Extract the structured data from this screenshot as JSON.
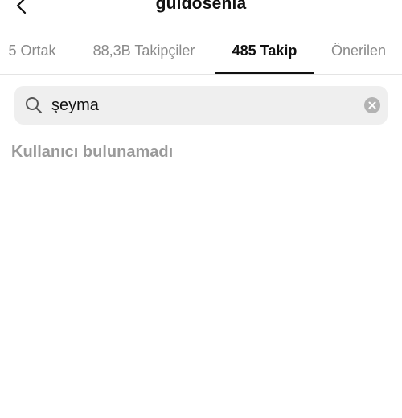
{
  "header": {
    "back_icon": "chevron-left-icon",
    "title": "guidosenia"
  },
  "tabs": [
    {
      "label": "5 Ortak",
      "active": false
    },
    {
      "label": "88,3B Takipçiler",
      "active": false
    },
    {
      "label": "485 Takip",
      "active": true
    },
    {
      "label": "Önerilen",
      "active": false
    }
  ],
  "search": {
    "icon": "search-icon",
    "value": "şeyma",
    "clear_icon": "clear-icon"
  },
  "results": {
    "empty_message": "Kullanıcı bulunamadı"
  },
  "colors": {
    "active_tab": "#111111",
    "inactive_tab": "#8a8a8a",
    "search_background": "#efefef",
    "empty_text": "#9a9a9a"
  }
}
